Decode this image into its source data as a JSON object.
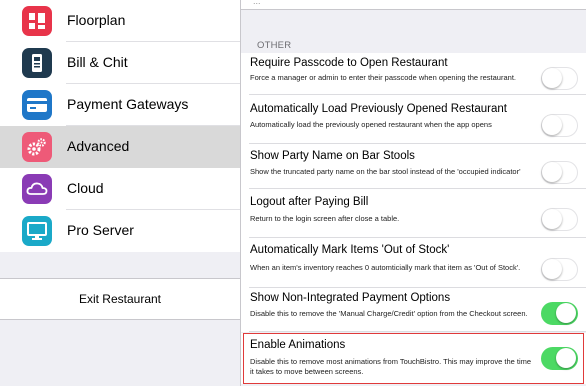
{
  "sidebar": {
    "items": [
      {
        "label": "Floorplan",
        "icon": "floorplan-icon",
        "color": "#e8344a"
      },
      {
        "label": "Bill & Chit",
        "icon": "receipt-printer-icon",
        "color": "#1f3a4f"
      },
      {
        "label": "Payment Gateways",
        "icon": "credit-card-icon",
        "color": "#1f77c8"
      },
      {
        "label": "Advanced",
        "icon": "gears-icon",
        "color": "#ee5a78",
        "selected": true
      },
      {
        "label": "Cloud",
        "icon": "cloud-icon",
        "color": "#8a3bb5"
      },
      {
        "label": "Pro Server",
        "icon": "monitor-icon",
        "color": "#1aa9c8"
      }
    ],
    "exit_label": "Exit Restaurant"
  },
  "content": {
    "top_cut_text": "...",
    "section_header": "OTHER",
    "settings": [
      {
        "title": "Require Passcode to Open Restaurant",
        "description": "Force a manager or admin to enter their passcode when opening the restaurant.",
        "on": false
      },
      {
        "title": "Automatically Load Previously Opened Restaurant",
        "description": "Automatically load the previously opened restaurant when the app opens",
        "on": false
      },
      {
        "title": "Show Party Name on Bar Stools",
        "description": "Show the truncated party name on the bar stool instead of the 'occupied indicator'",
        "on": false
      },
      {
        "title": "Logout after Paying Bill",
        "description": "Return to the login screen after close a table.",
        "on": false
      },
      {
        "title": "Automatically Mark Items 'Out of Stock'",
        "description": "When an item's inventory reaches 0 automticially mark that item as 'Out of Stock'.",
        "on": false
      },
      {
        "title": "Show Non-Integrated Payment Options",
        "description": "Disable this to remove the 'Manual Charge/Credit' option from the Checkout screen.",
        "on": true
      },
      {
        "title": "Enable Animations",
        "description": "Disable this to remove most animations from TouchBistro. This may improve the time it takes to move between screens.",
        "on": true,
        "highlighted": true
      }
    ]
  },
  "colors": {
    "toggle_on": "#4cd964",
    "highlight": "#e03a3a",
    "selected_row": "#d9d9d9"
  }
}
